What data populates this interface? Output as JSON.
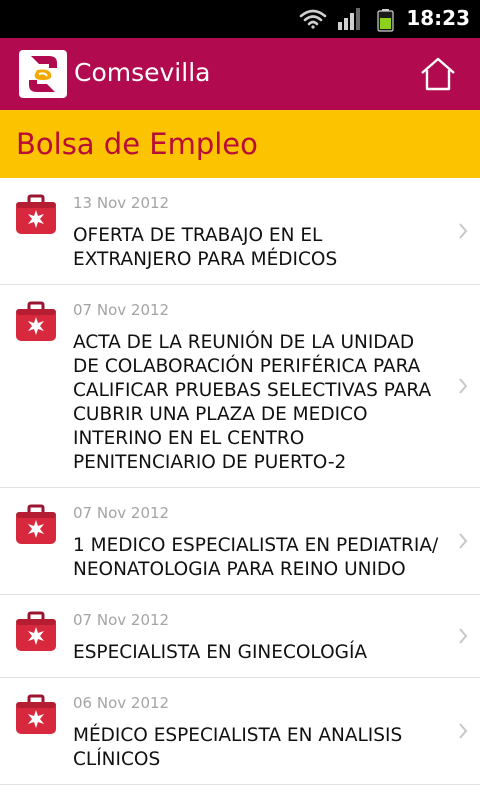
{
  "status_bar": {
    "time": "18:23"
  },
  "app_bar": {
    "title": "Comsevilla"
  },
  "section": {
    "title": "Bolsa de Empleo"
  },
  "items": [
    {
      "date": "13 Nov 2012",
      "title": "OFERTA DE TRABAJO EN EL EXTRANJERO PARA MÉDICOS"
    },
    {
      "date": "07 Nov 2012",
      "title": "ACTA DE LA REUNIÓN DE LA UNIDAD DE COLABORACIÓN PERIFÉRICA PARA CALIFICAR PRUEBAS SELECTIVAS PARA CUBRIR UNA PLAZA DE MEDICO INTERINO EN EL CENTRO PENITENCIARIO DE PUERTO-2"
    },
    {
      "date": "07 Nov 2012",
      "title": "1 MEDICO ESPECIALISTA EN PEDIATRIA/ NEONATOLOGIA PARA REINO UNIDO"
    },
    {
      "date": "07 Nov 2012",
      "title": "ESPECIALISTA EN GINECOLOGÍA"
    },
    {
      "date": "06 Nov 2012",
      "title": "MÉDICO ESPECIALISTA EN ANALISIS CLÍNICOS"
    }
  ],
  "icons": {
    "item_icon": "first-aid-kit-icon",
    "home": "home-icon",
    "chevron": "chevron-right-icon"
  },
  "colors": {
    "app_bar": "#b10a4f",
    "section_header": "#fcc400",
    "section_title": "#b80d36"
  }
}
